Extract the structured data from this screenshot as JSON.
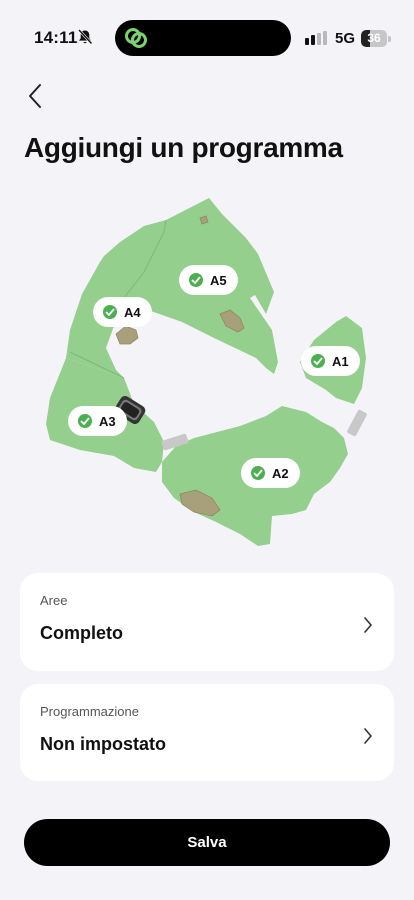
{
  "status_bar": {
    "time": "14:11",
    "network": "5G",
    "battery": "36",
    "battery_level_percent": 36,
    "icons": [
      "bell-muted-icon",
      "app-link-icon",
      "signal-icon",
      "battery-icon"
    ]
  },
  "header": {
    "back_icon": "chevron-left-icon",
    "title": "Aggiungi un programma"
  },
  "map": {
    "lawn_color": "#94cf8e",
    "zones": [
      {
        "id": "A5",
        "label": "A5",
        "checked": true
      },
      {
        "id": "A4",
        "label": "A4",
        "checked": true
      },
      {
        "id": "A1",
        "label": "A1",
        "checked": true
      },
      {
        "id": "A3",
        "label": "A3",
        "checked": true
      },
      {
        "id": "A2",
        "label": "A2",
        "checked": true
      }
    ]
  },
  "areas_card": {
    "label": "Aree",
    "value": "Completo",
    "icon": "chevron-right-icon"
  },
  "schedule_card": {
    "label": "Programmazione",
    "value": "Non impostato",
    "icon": "chevron-right-icon"
  },
  "save_button": {
    "label": "Salva",
    "color": "#000000"
  }
}
